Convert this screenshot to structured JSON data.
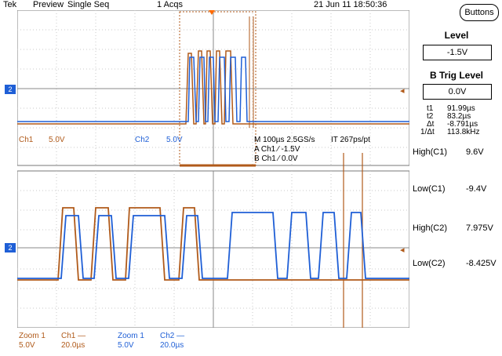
{
  "header": {
    "brand": "Tek",
    "mode": "Preview",
    "seq": "Single Seq",
    "acqs": "1 Acqs",
    "datetime": "21 Jun 11 18:50:36"
  },
  "buttons": {
    "label": "Buttons"
  },
  "trigger": {
    "level_label": "Level",
    "level_value": "-1.5V",
    "btrig_label": "B Trig Level",
    "btrig_value": "0.0V"
  },
  "cursors": {
    "t1_label": "t1",
    "t1_value": "91.99µs",
    "t2_label": "t2",
    "t2_value": "83.2µs",
    "dt_label": "Δt",
    "dt_value": "-8.791µs",
    "inv_label": "1/Δt",
    "inv_value": "113.8kHz"
  },
  "measurements": [
    {
      "label": "High(C1)",
      "value": "9.6V"
    },
    {
      "label": "Low(C1)",
      "value": "-9.4V"
    },
    {
      "label": "High(C2)",
      "value": "7.975V"
    },
    {
      "label": "Low(C2)",
      "value": "-8.425V"
    }
  ],
  "upper_readout": {
    "ch1": "Ch1",
    "ch1_scale": "5.0V",
    "ch2": "Ch2",
    "ch2_scale": "5.0V",
    "timebase": "M 100µs 2.5GS/s",
    "it": "IT 267ps/pt",
    "trig_a": "A  Ch1  ⁄  -1.5V",
    "trig_b": "B  Ch1  ⁄  0.0V"
  },
  "zoom_readout": [
    {
      "zoom": "Zoom 1",
      "ch": "Ch1 —",
      "volts": "5.0V",
      "time": "20.0µs"
    },
    {
      "zoom": "Zoom 1",
      "ch": "Ch2 —",
      "volts": "5.0V",
      "time": "20.0µs"
    }
  ],
  "markers": {
    "ch2": "2"
  },
  "colors": {
    "ch1": "#b05a1a",
    "ch2": "#1f5fd6",
    "grid": "#9a9a9a"
  }
}
